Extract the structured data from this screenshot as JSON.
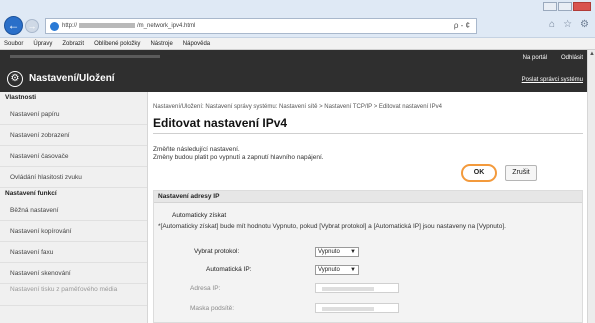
{
  "browser": {
    "url_prefix": "http://",
    "url_suffix": "/m_network_ipv4.html",
    "search_glyph": "ρ - ¢"
  },
  "menu": [
    "Soubor",
    "Úpravy",
    "Zobrazit",
    "Oblíbené položky",
    "Nástroje",
    "Nápověda"
  ],
  "header": {
    "title": "Nastavení/Uložení",
    "portal": "Na portál",
    "logout": "Odhlásit",
    "system_manager": "Poslat správci systému"
  },
  "sidebar": {
    "section1": "Vlastnosti",
    "items1": [
      "Nastavení papíru",
      "Nastavení zobrazení",
      "Nastavení časovače",
      "Ovládání hlasitosti zvuku"
    ],
    "section2": "Nastavení funkcí",
    "items2": [
      "Běžná nastavení",
      "Nastavení kopírování",
      "Nastavení faxu",
      "Nastavení skenování",
      "Nastavení tisku z paměťového média"
    ]
  },
  "main": {
    "breadcrumb": "Nastavení/Uložení: Nastavení správy systému: Nastavení sítě > Nastavení TCP/IP > Editovat nastavení IPv4",
    "title": "Editovat nastavení IPv4",
    "desc1": "Změňte následující nastavení.",
    "desc2": "Změny budou platit po vypnutí a zapnutí hlavního napájení.",
    "ok_label": "OK",
    "cancel_label": "Zrušit",
    "section_title": "Nastavení adresy IP",
    "auto_title": "Automaticky získat",
    "auto_note": "*[Automaticky získat] bude mít hodnotu Vypnuto, pokud [Vybrat protokol] a [Automatická IP] jsou nastaveny na [Vypnuto].",
    "select_protocol_label": "Vybrat protokol:",
    "select_protocol_value": "Vypnuto",
    "auto_ip_label": "Automatická IP:",
    "auto_ip_value": "Vypnuto",
    "ip_address_label": "Adresa IP:",
    "subnet_label": "Maska podsítě:"
  }
}
